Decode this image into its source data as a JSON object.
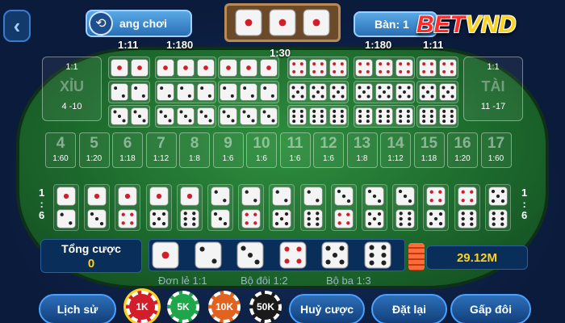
{
  "header": {
    "back_icon": "chevron-left-icon",
    "history_label": "ang chơi",
    "history_icon": "clock-history-icon",
    "result_dice": [
      1,
      1,
      1
    ],
    "table_label": "Bàn: 1",
    "logo_red": "BET",
    "logo_gold": "VND"
  },
  "ratios": {
    "r1": "1:11",
    "r2": "1:180",
    "r3": "1:30",
    "r4": "1:180",
    "r5": "1:11"
  },
  "xiu": {
    "ratio": "1:1",
    "label": "XỈU",
    "range": "4 -10"
  },
  "tai": {
    "ratio": "1:1",
    "label": "TÀI",
    "range": "11 -17"
  },
  "sums": [
    {
      "n": "4",
      "r": "1:60"
    },
    {
      "n": "5",
      "r": "1:20"
    },
    {
      "n": "6",
      "r": "1:18"
    },
    {
      "n": "7",
      "r": "1:12"
    },
    {
      "n": "8",
      "r": "1:8"
    },
    {
      "n": "9",
      "r": "1:6"
    },
    {
      "n": "10",
      "r": "1:6"
    },
    {
      "n": "11",
      "r": "1:6"
    },
    {
      "n": "12",
      "r": "1:6"
    },
    {
      "n": "13",
      "r": "1:8"
    },
    {
      "n": "14",
      "r": "1:12"
    },
    {
      "n": "15",
      "r": "1:18"
    },
    {
      "n": "16",
      "r": "1:20"
    },
    {
      "n": "17",
      "r": "1:60"
    }
  ],
  "pair_ratio": {
    "top": "1",
    "colon": ":",
    "bottom": "6"
  },
  "pairs": [
    [
      1,
      2
    ],
    [
      1,
      3
    ],
    [
      1,
      4
    ],
    [
      1,
      5
    ],
    [
      1,
      6
    ],
    [
      2,
      3
    ],
    [
      2,
      4
    ],
    [
      2,
      5
    ],
    [
      2,
      6
    ],
    [
      3,
      4
    ],
    [
      3,
      5
    ],
    [
      3,
      6
    ],
    [
      4,
      5
    ],
    [
      4,
      6
    ],
    [
      5,
      6
    ]
  ],
  "singles": [
    1,
    2,
    3,
    4,
    5,
    6
  ],
  "total": {
    "label": "Tổng cược",
    "value": "0"
  },
  "balance": "29.12M",
  "legend": {
    "single": "Đơn lẻ 1:1",
    "double": "Bộ đôi 1:2",
    "triple": "Bộ ba 1:3"
  },
  "buttons": {
    "history": "Lịch sử",
    "cancel": "Huỷ cược",
    "reset": "Đặt lại",
    "double": "Gấp đôi"
  },
  "chips": [
    {
      "label": "1K",
      "color": "#d21e2b"
    },
    {
      "label": "5K",
      "color": "#1fa64a"
    },
    {
      "label": "10K",
      "color": "#e2631f"
    },
    {
      "label": "50K",
      "color": "#1a1a1a"
    }
  ]
}
